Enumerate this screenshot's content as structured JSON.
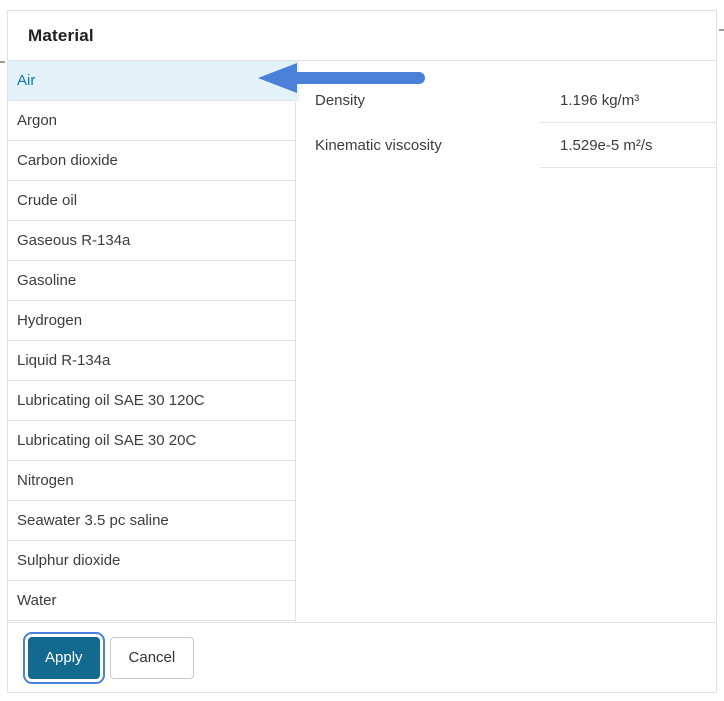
{
  "dialog": {
    "title": "Material",
    "materials": {
      "selected": "Air",
      "items": [
        "Air",
        "Argon",
        "Carbon dioxide",
        "Crude oil",
        "Gaseous R-134a",
        "Gasoline",
        "Hydrogen",
        "Liquid R-134a",
        "Lubricating oil SAE 30 120C",
        "Lubricating oil SAE 30 20C",
        "Nitrogen",
        "Seawater 3.5 pc saline",
        "Sulphur dioxide",
        "Water"
      ]
    },
    "properties": [
      {
        "label": "Density",
        "value": "1.196 kg/m³"
      },
      {
        "label": "Kinematic viscosity",
        "value": "1.529e-5 m²/s"
      }
    ],
    "footer": {
      "apply_label": "Apply",
      "cancel_label": "Cancel"
    }
  },
  "annotation": {
    "type": "left-arrow",
    "color": "#4a80d8"
  },
  "colors": {
    "selection_bg": "#e3f1f8",
    "selection_text": "#1378b5",
    "apply_button_bg": "#136a8e",
    "focus_ring": "#4a80d8",
    "border": "#e2e2e2"
  }
}
